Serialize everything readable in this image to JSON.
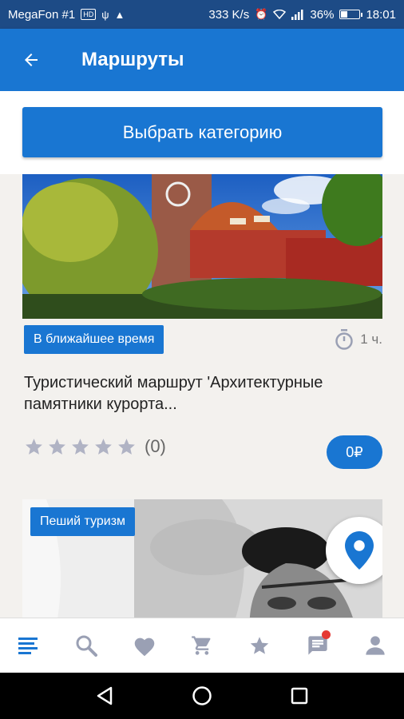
{
  "status_bar": {
    "carrier": "MegaFon #1",
    "net_badge": "HD",
    "speed": "333 K/s",
    "battery": "36%",
    "battery_level": 0.36,
    "time": "18:01"
  },
  "appbar": {
    "title": "Маршруты"
  },
  "category_button": {
    "label": "Выбрать категорию"
  },
  "routes": [
    {
      "tag": "В ближайшее время",
      "duration": "1 ч.",
      "title": "Туристический маршрут 'Архитектурные памятники курорта...",
      "rating_stars": 5,
      "rating_count": "(0)",
      "price": "0₽"
    },
    {
      "tag": "Пеший  туризм"
    }
  ],
  "bottom_nav": [
    "menu-icon",
    "search-icon",
    "heart-icon",
    "cart-icon",
    "star-icon",
    "chat-icon",
    "person-icon"
  ],
  "colors": {
    "primary": "#1976d2",
    "status_bar": "#1d4b86",
    "background": "#f3f1ee",
    "star": "#b0b3c4",
    "notification": "#e53935"
  }
}
